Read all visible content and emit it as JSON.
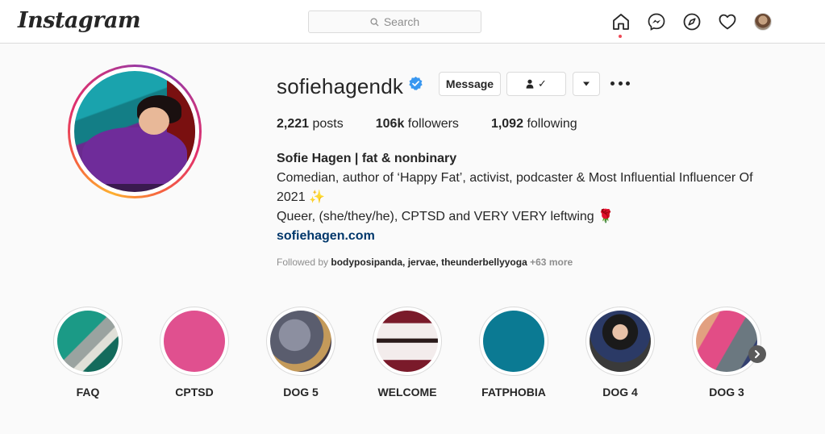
{
  "header": {
    "logo": "Instagram",
    "search_placeholder": "Search",
    "icons": [
      "home-icon",
      "messenger-icon",
      "explore-icon",
      "heart-icon",
      "avatar"
    ]
  },
  "profile": {
    "username": "sofiehagendk",
    "verified": true,
    "buttons": {
      "message": "Message",
      "follow_status": "✓",
      "dropdown": "▾"
    },
    "stats": [
      {
        "value": "2,221",
        "label": "posts"
      },
      {
        "value": "106k",
        "label": "followers"
      },
      {
        "value": "1,092",
        "label": "following"
      }
    ],
    "bio": {
      "name": "Sofie Hagen | fat & nonbinary",
      "line1": "Comedian, author of ‘Happy Fat’, activist, podcaster & Most Influential Influencer Of 2021 ✨",
      "line2": "Queer, (she/they/he), CPTSD and VERY VERY leftwing 🌹",
      "link": "sofiehagen.com"
    },
    "followed_by": {
      "prefix": "Followed by",
      "names": "bodyposipanda, jervae, theunderbellyyoga",
      "more": "+63 more"
    }
  },
  "highlights": [
    {
      "label": "FAQ"
    },
    {
      "label": "CPTSD"
    },
    {
      "label": "DOG 5"
    },
    {
      "label": "WELCOME"
    },
    {
      "label": "FATPHOBIA"
    },
    {
      "label": "DOG 4"
    },
    {
      "label": "DOG 3"
    }
  ],
  "colors": {
    "accent_link": "#00376b",
    "verified": "#3897f0",
    "notification": "#ed4956",
    "cptsd": "#e0508f",
    "fatphobia": "#0b7a93"
  }
}
